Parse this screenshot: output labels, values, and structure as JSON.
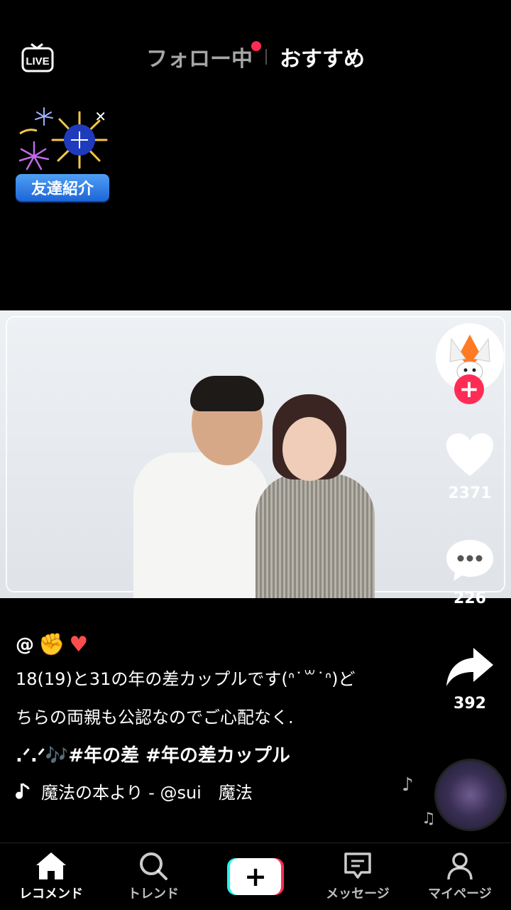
{
  "top_bar": {
    "live_label": "LIVE",
    "tabs": [
      {
        "label": "フォロー中",
        "active": false,
        "has_dot": true
      },
      {
        "label": "おすすめ",
        "active": true
      }
    ]
  },
  "friend_banner": {
    "label": "友達紹介",
    "close_icon": "close-icon"
  },
  "actions": {
    "likes": "2371",
    "comments": "226",
    "shares": "392"
  },
  "caption": {
    "username": "@",
    "description_line1": "18(19)と31の年の差カップルです(ᐢ˙꒳˙ᐢ)ど",
    "description_line2": "ちらの両親も公認なのでご心配なく.",
    "hashtags": ".ᐟ.ᐟ🎶#年の差 #年の差カップル",
    "music": "魔法の本より - @sui　魔法"
  },
  "bottom_nav": {
    "items": [
      {
        "label": "レコメンド",
        "icon": "home-icon"
      },
      {
        "label": "トレンド",
        "icon": "search-icon"
      },
      {
        "label": "",
        "icon": "plus-icon"
      },
      {
        "label": "メッセージ",
        "icon": "message-icon"
      },
      {
        "label": "マイページ",
        "icon": "profile-icon"
      }
    ]
  },
  "colors": {
    "accent": "#fe2c55",
    "cyan": "#25f4ee",
    "background": "#000000"
  }
}
